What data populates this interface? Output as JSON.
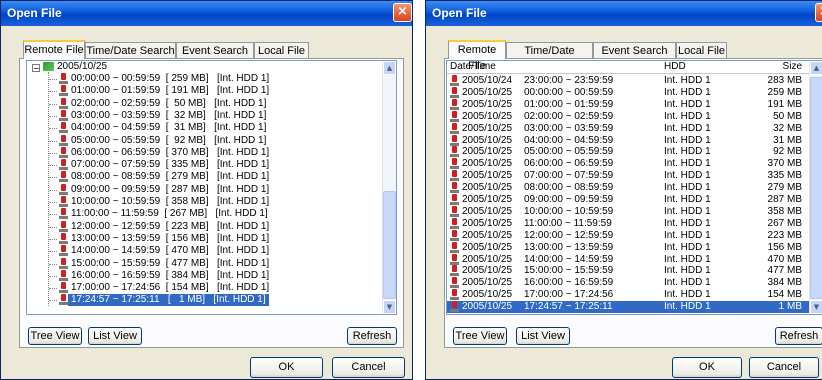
{
  "dialog_title": "Open File",
  "tabs": [
    "Remote File",
    "Time/Date Search",
    "Event Search",
    "Local File"
  ],
  "tree": {
    "root": "2005/10/25",
    "items": [
      "00:00:00 ~ 00:59:59  [ 259 MB]   [Int. HDD 1]",
      "01:00:00 ~ 01:59:59  [ 191 MB]   [Int. HDD 1]",
      "02:00:00 ~ 02:59:59  [  50 MB]   [Int. HDD 1]",
      "03:00:00 ~ 03:59:59  [  32 MB]   [Int. HDD 1]",
      "04:00:00 ~ 04:59:59  [  31 MB]   [Int. HDD 1]",
      "05:00:00 ~ 05:59:59  [  92 MB]   [Int. HDD 1]",
      "06:00:00 ~ 06:59:59  [ 370 MB]   [Int. HDD 1]",
      "07:00:00 ~ 07:59:59  [ 335 MB]   [Int. HDD 1]",
      "08:00:00 ~ 08:59:59  [ 279 MB]   [Int. HDD 1]",
      "09:00:00 ~ 09:59:59  [ 287 MB]   [Int. HDD 1]",
      "10:00:00 ~ 10:59:59  [ 358 MB]   [Int. HDD 1]",
      "11:00:00 ~ 11:59:59  [ 267 MB]   [Int. HDD 1]",
      "12:00:00 ~ 12:59:59  [ 223 MB]   [Int. HDD 1]",
      "13:00:00 ~ 13:59:59  [ 156 MB]   [Int. HDD 1]",
      "14:00:00 ~ 14:59:59  [ 470 MB]   [Int. HDD 1]",
      "15:00:00 ~ 15:59:59  [ 477 MB]   [Int. HDD 1]",
      "16:00:00 ~ 16:59:59  [ 384 MB]   [Int. HDD 1]",
      "17:00:00 ~ 17:24:56  [ 154 MB]   [Int. HDD 1]",
      "17:24:57 ~ 17:25:11   [   1 MB]   [Int. HDD 1]"
    ]
  },
  "list": {
    "headers": {
      "date_time": "Date/Time",
      "hdd": "HDD",
      "size": "Size"
    },
    "rows": [
      [
        "2005/10/24",
        "23:00:00 ~ 23:59:59",
        "Int. HDD 1",
        "283 MB"
      ],
      [
        "2005/10/25",
        "00:00:00 ~ 00:59:59",
        "Int. HDD 1",
        "259 MB"
      ],
      [
        "2005/10/25",
        "01:00:00 ~ 01:59:59",
        "Int. HDD 1",
        "191 MB"
      ],
      [
        "2005/10/25",
        "02:00:00 ~ 02:59:59",
        "Int. HDD 1",
        "50 MB"
      ],
      [
        "2005/10/25",
        "03:00:00 ~ 03:59:59",
        "Int. HDD 1",
        "32 MB"
      ],
      [
        "2005/10/25",
        "04:00:00 ~ 04:59:59",
        "Int. HDD 1",
        "31 MB"
      ],
      [
        "2005/10/25",
        "05:00:00 ~ 05:59:59",
        "Int. HDD 1",
        "92 MB"
      ],
      [
        "2005/10/25",
        "06:00:00 ~ 06:59:59",
        "Int. HDD 1",
        "370 MB"
      ],
      [
        "2005/10/25",
        "07:00:00 ~ 07:59:59",
        "Int. HDD 1",
        "335 MB"
      ],
      [
        "2005/10/25",
        "08:00:00 ~ 08:59:59",
        "Int. HDD 1",
        "279 MB"
      ],
      [
        "2005/10/25",
        "09:00:00 ~ 09:59:59",
        "Int. HDD 1",
        "287 MB"
      ],
      [
        "2005/10/25",
        "10:00:00 ~ 10:59:59",
        "Int. HDD 1",
        "358 MB"
      ],
      [
        "2005/10/25",
        "11:00:00 ~ 11:59:59",
        "Int. HDD 1",
        "267 MB"
      ],
      [
        "2005/10/25",
        "12:00:00 ~ 12:59:59",
        "Int. HDD 1",
        "223 MB"
      ],
      [
        "2005/10/25",
        "13:00:00 ~ 13:59:59",
        "Int. HDD 1",
        "156 MB"
      ],
      [
        "2005/10/25",
        "14:00:00 ~ 14:59:59",
        "Int. HDD 1",
        "470 MB"
      ],
      [
        "2005/10/25",
        "15:00:00 ~ 15:59:59",
        "Int. HDD 1",
        "477 MB"
      ],
      [
        "2005/10/25",
        "16:00:00 ~ 16:59:59",
        "Int. HDD 1",
        "384 MB"
      ],
      [
        "2005/10/25",
        "17:00:00 ~ 17:24:56",
        "Int. HDD 1",
        "154 MB"
      ],
      [
        "2005/10/25",
        "17:24:57 ~ 17:25:11",
        "Int. HDD 1",
        "1 MB"
      ]
    ]
  },
  "buttons": {
    "tree_view": "Tree View",
    "list_view": "List View",
    "refresh": "Refresh",
    "ok": "OK",
    "cancel": "Cancel"
  },
  "selected_index_tree": 18,
  "selected_index_list": 19,
  "colors": {
    "selection": "#316ac5",
    "titlebar": "#0a58d8",
    "close": "#d8431f",
    "record_icon": "#cc2222"
  }
}
